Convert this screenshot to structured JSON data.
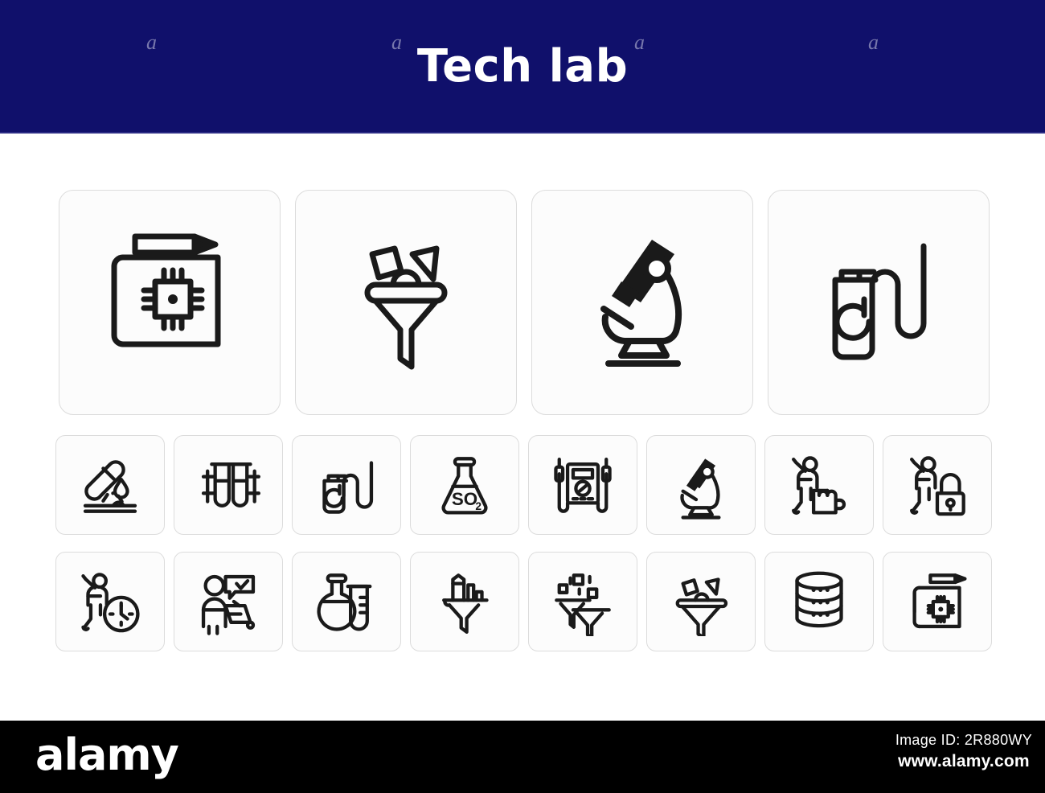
{
  "header": {
    "title": "Tech lab",
    "background_color": "#10106b",
    "title_color": "#ffffff",
    "watermark_char": "a"
  },
  "footer": {
    "logo": "alamy",
    "image_id_label": "Image ID: 2R880WY",
    "url": "www.alamy.com",
    "background_color": "#000000",
    "text_color": "#ffffff"
  },
  "grid": {
    "tile_border_color": "#dcdcdc",
    "tile_background": "#fcfcfc",
    "icon_color": "#1a1a1a",
    "large_row": [
      {
        "name": "blueprint-microchip-pencil",
        "label": "Chip blueprint with pencil"
      },
      {
        "name": "funnel-shapes",
        "label": "Data filter funnel with shapes"
      },
      {
        "name": "microscope",
        "label": "Microscope"
      },
      {
        "name": "gas-canister-coil",
        "label": "Gas canister with coil tube"
      }
    ],
    "small_row_2": [
      {
        "name": "test-tube-drop",
        "label": "Test tube pouring drop"
      },
      {
        "name": "test-tubes-rack",
        "label": "Test tubes in rack"
      },
      {
        "name": "gas-canister-coil",
        "label": "Gas canister with coil tube"
      },
      {
        "name": "flask-so2",
        "label": "Flask SO2",
        "text": "SO",
        "subscript": "2"
      },
      {
        "name": "multimeter",
        "label": "Multimeter with probes"
      },
      {
        "name": "microscope",
        "label": "Microscope"
      },
      {
        "name": "person-puzzle",
        "label": "Person with puzzle piece"
      },
      {
        "name": "person-padlock",
        "label": "Person with padlock"
      }
    ],
    "small_row_3": [
      {
        "name": "person-clock",
        "label": "Person with clock"
      },
      {
        "name": "person-presentation-check",
        "label": "Person presenting with check mark"
      },
      {
        "name": "flask-test-tube",
        "label": "Round flask with test tube"
      },
      {
        "name": "funnel-bar-chart",
        "label": "Funnel with bar chart"
      },
      {
        "name": "double-funnel-squares",
        "label": "Two funnels with squares"
      },
      {
        "name": "funnel-shapes",
        "label": "Funnel with shapes"
      },
      {
        "name": "database-stack",
        "label": "Database stack"
      },
      {
        "name": "blueprint-microchip-pencil",
        "label": "Chip blueprint with pencil"
      }
    ]
  }
}
